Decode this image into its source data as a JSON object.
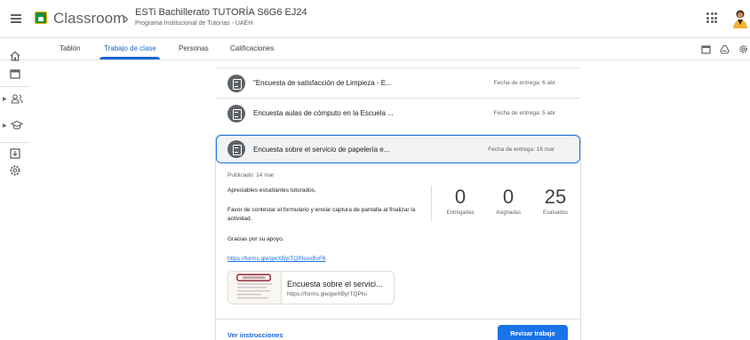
{
  "header": {
    "app_name": "Classroom",
    "breadcrumb_separator": "›",
    "class_title": "ESTi Bachillerato TUTORÍA S6G6 EJ24",
    "class_subtitle": "Programa Institucional de Tutorías - UAEH"
  },
  "tabs": [
    {
      "label": "Tablón",
      "active": false
    },
    {
      "label": "Trabajo de clase",
      "active": true
    },
    {
      "label": "Personas",
      "active": false
    },
    {
      "label": "Calificaciones",
      "active": false
    }
  ],
  "tab_icons": [
    "calendar-icon",
    "drive-icon",
    "settings-icon"
  ],
  "rail_icons": [
    "home-icon",
    "calendar-icon",
    "people-icon",
    "school-icon",
    "archive-icon",
    "settings-icon"
  ],
  "assignments": [
    {
      "title": "\"Encuesta de satisfacción de Limpieza - E...",
      "due": "Fecha de entrega: 6 abr"
    },
    {
      "title": "Encuesta aulas de cómputo en la Escuela ...",
      "due": "Fecha de entrega: 5 abr"
    }
  ],
  "expanded": {
    "title": "Encuesta sobre el servicio de papelería e...",
    "due": "Fecha de entrega: 16 mar",
    "posted": "Publicado: 14 mar",
    "body": [
      "Apreciables estudiantes tutorados,",
      "Favor de contestar el formulario y enviar captura de pantalla al finalizar la actividad.",
      "Gracias por su apoyo."
    ],
    "link": "https://forms.gle/gwXByrTQPlsoxBxF6",
    "stats": [
      {
        "value": "0",
        "label": "Entregadas"
      },
      {
        "value": "0",
        "label": "Asignadas"
      },
      {
        "value": "25",
        "label": "Evaluados"
      }
    ],
    "attachment": {
      "title": "Encuesta sobre el servici...",
      "url": "https://forms.gle/gwXByrTQPlsi"
    },
    "view_instructions": "Ver instrucciones",
    "review_button": "Revisar trabajo"
  },
  "colors": {
    "accent": "#1a73e8",
    "active_tab": "#1967d2",
    "icon_gray": "#5f6368",
    "logo_green": "#1e8e3e"
  }
}
